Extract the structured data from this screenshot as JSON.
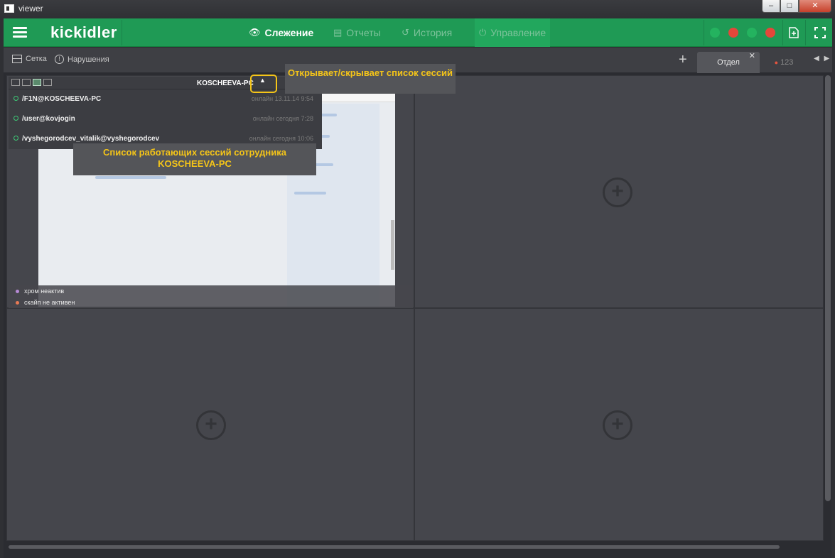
{
  "window": {
    "title": "viewer",
    "min": "–",
    "max": "□",
    "close": "✕"
  },
  "header": {
    "logo": "kickidler",
    "nav": [
      {
        "label": "Слежение"
      },
      {
        "label": "Отчеты"
      },
      {
        "label": "История"
      },
      {
        "label": "Управление"
      }
    ],
    "status_colors": [
      "#24b35f",
      "#e4473a",
      "#24b35f",
      "#e4473a"
    ],
    "add_window_icon": "add-window-icon",
    "fullscreen_icon": "fullscreen-icon"
  },
  "toolbar": {
    "grid_label": "Сетка",
    "violations_label": "Нарушения",
    "add_tab": "+",
    "tabs": [
      {
        "label": "Отдел",
        "close": "✕"
      },
      {
        "label": "123"
      }
    ],
    "arrows": "◀ ▶"
  },
  "monitor": {
    "computer_name": "KOSCHEEVA-PC",
    "toggle": "▲",
    "sessions": [
      {
        "name": "/F1N@KOSCHEEVA-PC",
        "time": "онлайн 13.11.14 9:54"
      },
      {
        "name": "/user@kovjogin",
        "time": "онлайн сегодня 7:28"
      },
      {
        "name": "/vyshegorodcev_vitalik@vyshegorodcev",
        "time": "онлайн сегодня 10:06"
      }
    ],
    "apps": [
      {
        "label": "хром неактив",
        "color": "#b78ad6"
      },
      {
        "label": "скайп не активен",
        "color": "#e87a55"
      }
    ]
  },
  "cells": {
    "add_symbol": "+"
  },
  "callouts": {
    "toggle_hint": "Открывает/скрывает список сессий",
    "sessions_hint": "Список работающих сессий сотрудника KOSCHEEVA-PC"
  }
}
